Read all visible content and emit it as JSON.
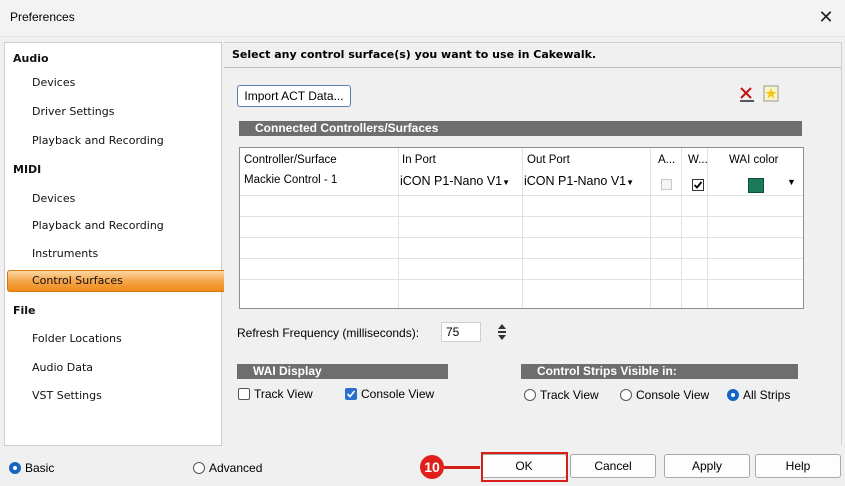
{
  "window": {
    "title": "Preferences",
    "close_glyph": "✕"
  },
  "sidebar": {
    "categories": [
      {
        "label": "Audio"
      },
      {
        "label": "MIDI"
      },
      {
        "label": "File"
      }
    ],
    "items": [
      {
        "label": "Devices"
      },
      {
        "label": "Driver Settings"
      },
      {
        "label": "Playback and Recording"
      },
      {
        "label": "Devices"
      },
      {
        "label": "Playback and Recording"
      },
      {
        "label": "Instruments"
      },
      {
        "label": "Control Surfaces",
        "selected": true
      },
      {
        "label": "Folder Locations"
      },
      {
        "label": "Audio Data"
      },
      {
        "label": "VST Settings"
      }
    ]
  },
  "main": {
    "heading": "Select any control surface(s) you want to use in Cakewalk.",
    "import_button": "Import ACT Data...",
    "delete_icon": "delete-controller-icon",
    "add_icon": "add-controller-icon",
    "connected_banner": "Connected Controllers/Surfaces",
    "table": {
      "headers": [
        "Controller/Surface",
        "In Port",
        "Out Port",
        "A...",
        "W...",
        "WAI color"
      ],
      "rows": [
        {
          "controller": "Mackie Control - 1",
          "in_port": "iCON P1-Nano V1",
          "out_port": "iCON P1-Nano V1",
          "a_checked": false,
          "w_checked": true,
          "wai_color": "#1a7a5a"
        }
      ]
    },
    "refresh_label": "Refresh Frequency (milliseconds):",
    "refresh_value": "75",
    "wai_display": {
      "banner": "WAI Display",
      "track_view": {
        "label": "Track View",
        "checked": false
      },
      "console_view": {
        "label": "Console View",
        "checked": true
      }
    },
    "control_strips": {
      "banner": "Control Strips Visible in:",
      "options": [
        {
          "label": "Track View",
          "selected": false
        },
        {
          "label": "Console View",
          "selected": false
        },
        {
          "label": "All Strips",
          "selected": true
        }
      ]
    }
  },
  "footer": {
    "mode_basic": "Basic",
    "mode_advanced": "Advanced",
    "mode_selected": "Basic",
    "step_badge": "10",
    "ok": "OK",
    "cancel": "Cancel",
    "apply": "Apply",
    "help": "Help"
  },
  "colors": {
    "accent": "#1765c2",
    "selected_orange": "#f6a64a",
    "annotation_red": "#d61f1a",
    "banner_gray": "#6e6e6e"
  }
}
